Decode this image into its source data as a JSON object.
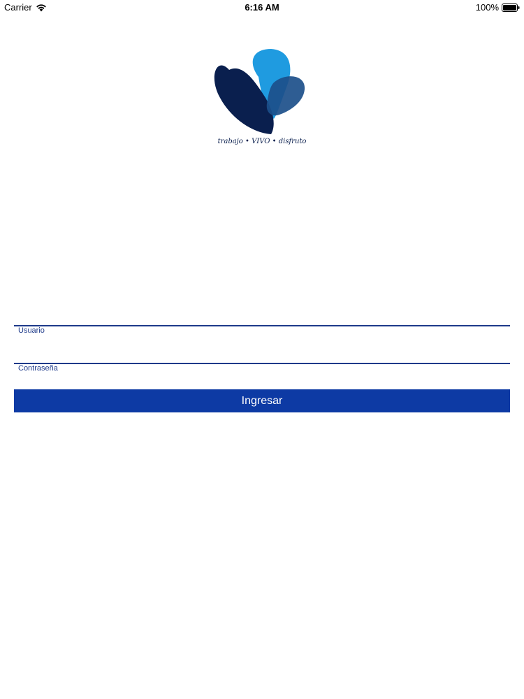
{
  "status_bar": {
    "carrier": "Carrier",
    "time": "6:16 AM",
    "battery": "100%",
    "wifi_icon": "wifi-icon",
    "battery_icon": "battery-icon"
  },
  "logo": {
    "tagline": "trabajo • VIVO • disfruto",
    "colors": {
      "dark_navy": "#0a1f4e",
      "sky_blue": "#1f9be0",
      "steel_blue": "#1c4f8a"
    }
  },
  "form": {
    "username_label": "Usuario",
    "username_value": "",
    "password_label": "Contraseña",
    "password_value": "",
    "submit_label": "Ingresar"
  },
  "colors": {
    "accent": "#0d3aa4",
    "field_line": "#1e3a8a"
  }
}
